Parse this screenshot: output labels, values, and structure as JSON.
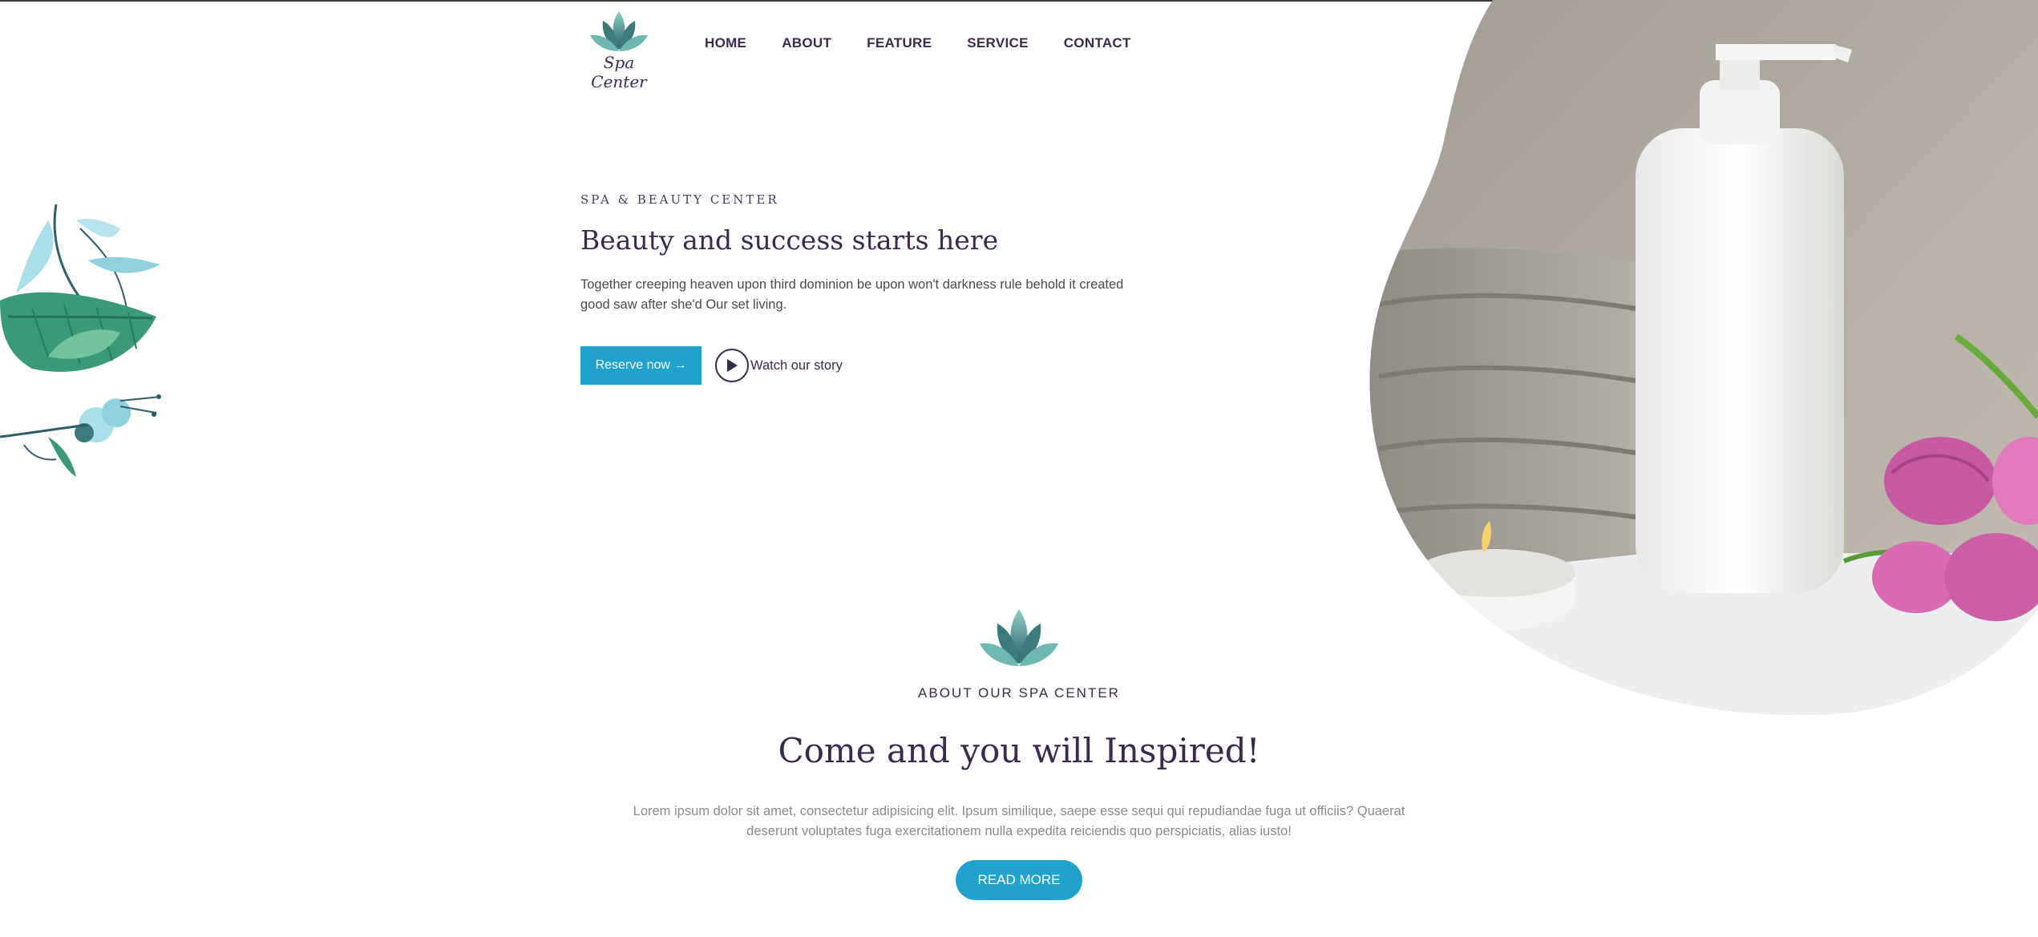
{
  "header": {
    "logo_text": "Spa Center",
    "nav": [
      "HOME",
      "ABOUT",
      "FEATURE",
      "SERVICE",
      "CONTACT"
    ]
  },
  "hero": {
    "eyebrow": "SPA & BEAUTY CENTER",
    "title": "Beauty and success starts here",
    "text": "Together creeping heaven upon third dominion be upon won't darkness rule behold it created good saw after she'd Our set living.",
    "reserve_label": "Reserve now →",
    "watch_label": "Watch our story"
  },
  "about": {
    "eyebrow": "ABOUT OUR SPA CENTER",
    "title": "Come and you will Inspired!",
    "text": "Lorem ipsum dolor sit amet, consectetur adipisicing elit. Ipsum similique, saepe esse sequi qui repudiandae fuga ut officiis? Quaerat deserunt voluptates fuga exercitationem nulla expedita reiciendis quo perspiciatis, alias iusto!",
    "read_more_label": "READ MORE"
  },
  "icons": {
    "logo": "lotus-icon",
    "play": "play-icon",
    "decor": "leaves-decoration",
    "hero_image": "spa-bottle-towel-photo"
  },
  "colors": {
    "accent": "#1fa3cc",
    "heading": "#3b2a4d",
    "lotus_dark": "#2f6e6a",
    "lotus_light": "#7cc4be"
  }
}
